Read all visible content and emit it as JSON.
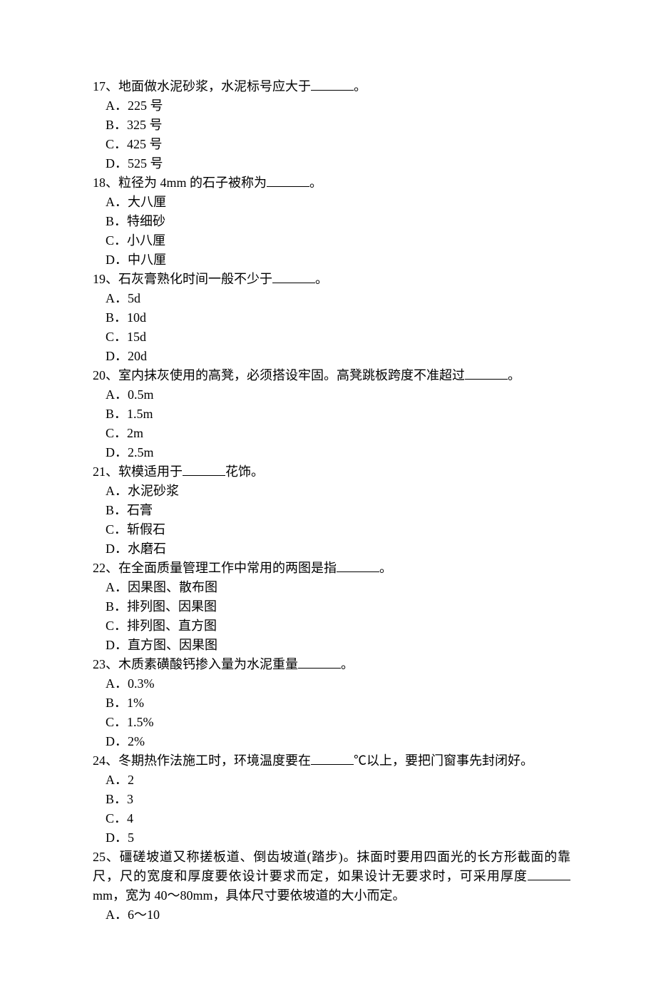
{
  "questions": [
    {
      "num": "17",
      "text_before": "地面做水泥砂浆，水泥标号应大于",
      "text_after": "。",
      "options": [
        {
          "label": "A",
          "text": "225 号"
        },
        {
          "label": "B",
          "text": "325 号"
        },
        {
          "label": "C",
          "text": "425 号"
        },
        {
          "label": "D",
          "text": "525 号"
        }
      ]
    },
    {
      "num": "18",
      "text_before": "粒径为 4mm 的石子被称为",
      "text_after": "。",
      "options": [
        {
          "label": "A",
          "text": "大八厘"
        },
        {
          "label": "B",
          "text": "特细砂"
        },
        {
          "label": "C",
          "text": "小八厘"
        },
        {
          "label": "D",
          "text": "中八厘"
        }
      ]
    },
    {
      "num": "19",
      "text_before": "石灰膏熟化时间一般不少于",
      "text_after": "。",
      "options": [
        {
          "label": "A",
          "text": "5d"
        },
        {
          "label": "B",
          "text": "10d"
        },
        {
          "label": "C",
          "text": "15d"
        },
        {
          "label": "D",
          "text": "20d"
        }
      ]
    },
    {
      "num": "20",
      "text_before": "室内抹灰使用的高凳，必须搭设牢固。高凳跳板跨度不准超过",
      "text_after": "。",
      "options": [
        {
          "label": "A",
          "text": "0.5m"
        },
        {
          "label": "B",
          "text": "1.5m"
        },
        {
          "label": "C",
          "text": "2m"
        },
        {
          "label": "D",
          "text": "2.5m"
        }
      ]
    },
    {
      "num": "21",
      "text_before": "软模适用于",
      "text_after": "花饰。",
      "options": [
        {
          "label": "A",
          "text": "水泥砂浆"
        },
        {
          "label": "B",
          "text": "石膏"
        },
        {
          "label": "C",
          "text": "斩假石"
        },
        {
          "label": "D",
          "text": "水磨石"
        }
      ]
    },
    {
      "num": "22",
      "text_before": "在全面质量管理工作中常用的两图是指",
      "text_after": "。",
      "options": [
        {
          "label": "A",
          "text": "因果图、散布图"
        },
        {
          "label": "B",
          "text": "排列图、因果图"
        },
        {
          "label": "C",
          "text": "排列图、直方图"
        },
        {
          "label": "D",
          "text": "直方图、因果图"
        }
      ]
    },
    {
      "num": "23",
      "text_before": "木质素磺酸钙掺入量为水泥重量",
      "text_after": "。",
      "options": [
        {
          "label": "A",
          "text": "0.3%"
        },
        {
          "label": "B",
          "text": "1%"
        },
        {
          "label": "C",
          "text": "1.5%"
        },
        {
          "label": "D",
          "text": "2%"
        }
      ]
    },
    {
      "num": "24",
      "text_before": "冬期热作法施工时，环境温度要在",
      "text_after": "℃以上，要把门窗事先封闭好。",
      "options": [
        {
          "label": "A",
          "text": "2"
        },
        {
          "label": "B",
          "text": "3"
        },
        {
          "label": "C",
          "text": "4"
        },
        {
          "label": "D",
          "text": "5"
        }
      ]
    },
    {
      "num": "25",
      "text_before": "礓磋坡道又称搓板道、倒齿坡道(踏步)。抹面时要用四面光的长方形截面的靠尺，尺的宽度和厚度要依设计要求而定，如果设计无要求时，可采用厚度",
      "text_after": "mm，宽为 40～80mm，具体尺寸要依坡道的大小而定。",
      "options": [
        {
          "label": "A",
          "text": "6～10"
        }
      ]
    }
  ],
  "separators": {
    "num_sep": "、",
    "opt_sep": "．"
  }
}
